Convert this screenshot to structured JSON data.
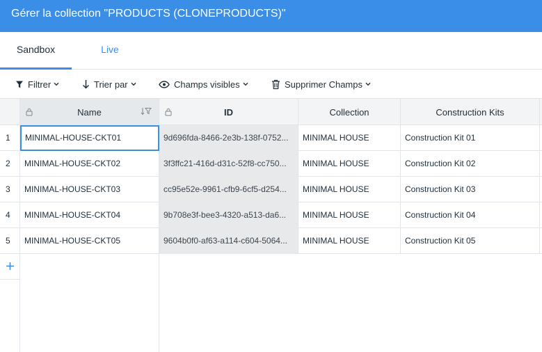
{
  "header": {
    "title": "Gérer la collection \"PRODUCTS (CLONEPRODUCTS)\""
  },
  "tabs": [
    {
      "label": "Sandbox",
      "active": true
    },
    {
      "label": "Live",
      "active": false
    }
  ],
  "toolbar": {
    "filter_label": "Filtrer",
    "sort_label": "Trier par",
    "fields_label": "Champs visibles",
    "delete_label": "Supprimer Champs"
  },
  "table": {
    "columns": [
      "Name",
      "ID",
      "Collection",
      "Construction Kits"
    ],
    "rows": [
      {
        "index": "1",
        "name": "MINIMAL-HOUSE-CKT01",
        "id": "9d696fda-8466-2e3b-138f-0752...",
        "collection": "MINIMAL HOUSE",
        "kit": "Construction Kit 01"
      },
      {
        "index": "2",
        "name": "MINIMAL-HOUSE-CKT02",
        "id": "3f3ffc21-416d-d31c-52f8-cc750...",
        "collection": "MINIMAL HOUSE",
        "kit": "Construction Kit 02"
      },
      {
        "index": "3",
        "name": "MINIMAL-HOUSE-CKT03",
        "id": "cc95e52e-9961-cfb9-6cf5-d254...",
        "collection": "MINIMAL HOUSE",
        "kit": "Construction Kit 03"
      },
      {
        "index": "4",
        "name": "MINIMAL-HOUSE-CKT04",
        "id": "9b708e3f-bee3-4320-a513-da6...",
        "collection": "MINIMAL HOUSE",
        "kit": "Construction Kit 04"
      },
      {
        "index": "5",
        "name": "MINIMAL-HOUSE-CKT05",
        "id": "9604b0f0-af63-a114-c604-5064...",
        "collection": "MINIMAL HOUSE",
        "kit": "Construction Kit 05"
      }
    ]
  },
  "colors": {
    "accent": "#3b8ee6",
    "header_bg": "#3b8ee6",
    "id_cell_bg": "#e8e9ea"
  },
  "icons": [
    "filter-icon",
    "sort-icon",
    "eye-icon",
    "trash-icon",
    "chevron-down-icon",
    "lock-icon",
    "sort-filter-icon",
    "plus-icon"
  ]
}
